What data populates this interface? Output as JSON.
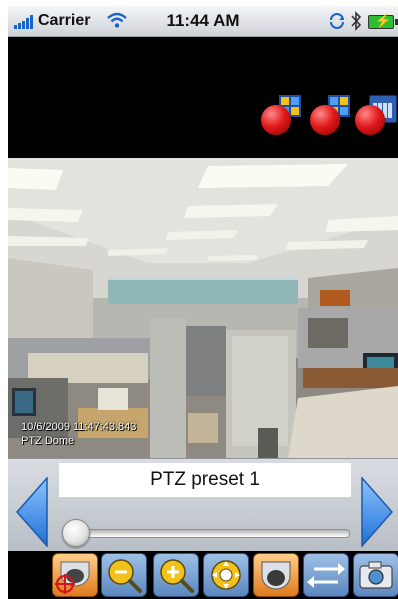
{
  "status_bar": {
    "carrier": "Carrier",
    "time": "11:44 AM",
    "icons": [
      "signal-icon",
      "wifi-icon",
      "sync-icon",
      "bluetooth-icon",
      "battery-charging-icon"
    ]
  },
  "top_controls": [
    {
      "name": "camera-group-1-button",
      "icon": "multi-camera-grid-icon"
    },
    {
      "name": "camera-group-2-button",
      "icon": "multi-camera-grid-icon"
    },
    {
      "name": "schedule-button",
      "icon": "calendar-icon"
    }
  ],
  "video": {
    "timestamp": "10/6/2009 11:47:43.843",
    "camera_name": "PTZ Dome"
  },
  "preset": {
    "label": "PTZ preset 1",
    "slider_value": 0
  },
  "toolbar": [
    {
      "name": "ptz-target-button",
      "icon": "ptz-target-icon",
      "active": true
    },
    {
      "name": "zoom-out-button",
      "icon": "zoom-out-icon",
      "active": false
    },
    {
      "name": "zoom-in-button",
      "icon": "zoom-in-icon",
      "active": false
    },
    {
      "name": "focus-button",
      "icon": "focus-icon",
      "active": false
    },
    {
      "name": "dome-camera-button",
      "icon": "dome-camera-icon",
      "active": true
    },
    {
      "name": "swap-button",
      "icon": "swap-arrows-icon",
      "active": false
    },
    {
      "name": "snapshot-button",
      "icon": "camera-snapshot-icon",
      "active": false
    }
  ],
  "colors": {
    "accent_blue": "#2f7fe0",
    "active_orange": "#e07a1e",
    "record_red": "#e21a1a"
  }
}
